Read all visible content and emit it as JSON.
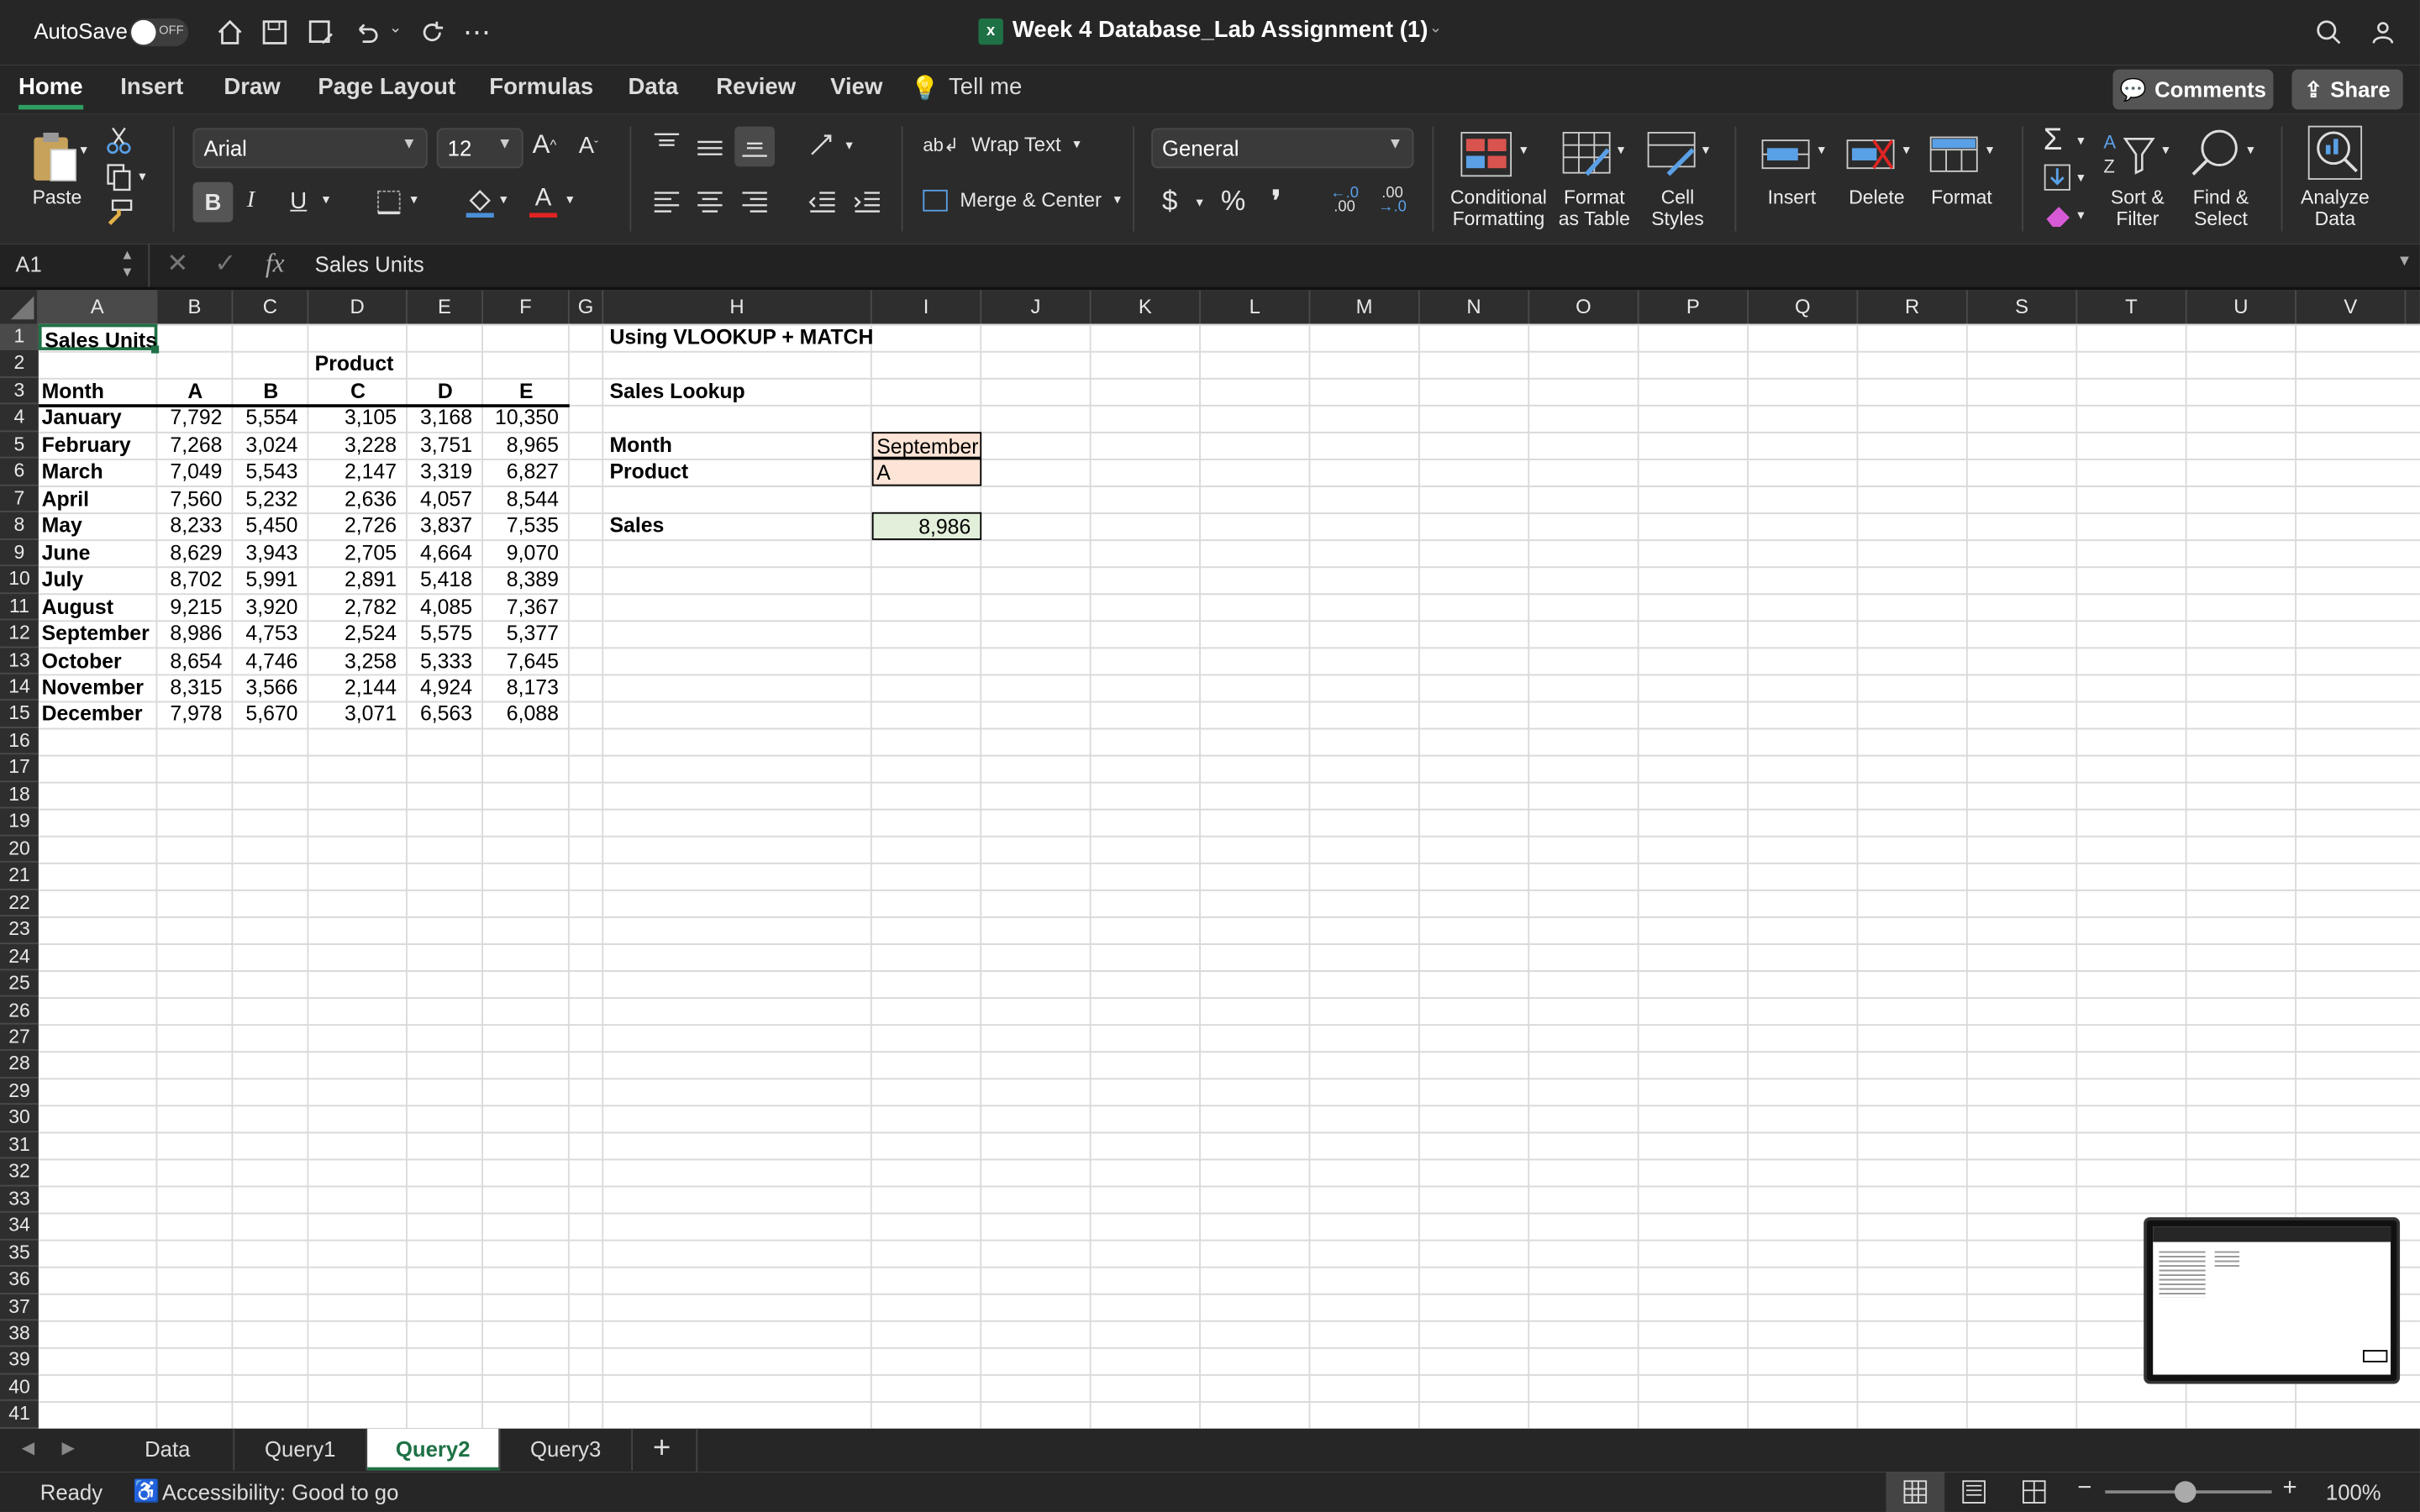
{
  "window": {
    "autosave_label": "AutoSave",
    "autosave_state": "OFF",
    "title": "Week 4 Database_Lab Assignment (1)"
  },
  "ribbon_tabs": [
    "Home",
    "Insert",
    "Draw",
    "Page Layout",
    "Formulas",
    "Data",
    "Review",
    "View"
  ],
  "tell_me": "Tell me",
  "comments_label": "Comments",
  "share_label": "Share",
  "home": {
    "paste": "Paste",
    "font_name": "Arial",
    "font_size": "12",
    "number_format": "General",
    "wrap_text": "Wrap Text",
    "merge_center": "Merge & Center",
    "conditional_formatting": [
      "Conditional",
      "Formatting"
    ],
    "format_as_table": [
      "Format",
      "as Table"
    ],
    "cell_styles": [
      "Cell",
      "Styles"
    ],
    "insert": "Insert",
    "delete": "Delete",
    "format": "Format",
    "sort_filter": [
      "Sort &",
      "Filter"
    ],
    "find_select": [
      "Find &",
      "Select"
    ],
    "analyze_data": [
      "Analyze",
      "Data"
    ]
  },
  "formula_bar": {
    "name_box": "A1",
    "fx": "fx",
    "content": "Sales Units"
  },
  "columns": [
    "A",
    "B",
    "C",
    "D",
    "E",
    "F",
    "G",
    "H",
    "I",
    "J",
    "K",
    "L",
    "M",
    "N",
    "O",
    "P",
    "Q",
    "R",
    "S",
    "T",
    "U",
    "V"
  ],
  "rows": [
    "1",
    "2",
    "3",
    "4",
    "5",
    "6",
    "7",
    "8",
    "9",
    "10",
    "11",
    "12",
    "13",
    "14",
    "15",
    "16",
    "17",
    "18",
    "19",
    "20",
    "21",
    "22",
    "23",
    "24",
    "25",
    "26",
    "27",
    "28",
    "29",
    "30",
    "31",
    "32",
    "33",
    "34",
    "35",
    "36",
    "37",
    "38",
    "39",
    "40",
    "41"
  ],
  "sheet": {
    "a1": "Sales Units",
    "product_header": "Product",
    "month_header": "Month",
    "products": [
      "A",
      "B",
      "C",
      "D",
      "E"
    ],
    "data": [
      [
        "January",
        "7,792",
        "5,554",
        "3,105",
        "3,168",
        "10,350"
      ],
      [
        "February",
        "7,268",
        "3,024",
        "3,228",
        "3,751",
        "8,965"
      ],
      [
        "March",
        "7,049",
        "5,543",
        "2,147",
        "3,319",
        "6,827"
      ],
      [
        "April",
        "7,560",
        "5,232",
        "2,636",
        "4,057",
        "8,544"
      ],
      [
        "May",
        "8,233",
        "5,450",
        "2,726",
        "3,837",
        "7,535"
      ],
      [
        "June",
        "8,629",
        "3,943",
        "2,705",
        "4,664",
        "9,070"
      ],
      [
        "July",
        "8,702",
        "5,991",
        "2,891",
        "5,418",
        "8,389"
      ],
      [
        "August",
        "9,215",
        "3,920",
        "2,782",
        "4,085",
        "7,367"
      ],
      [
        "September",
        "8,986",
        "4,753",
        "2,524",
        "5,575",
        "5,377"
      ],
      [
        "October",
        "8,654",
        "4,746",
        "3,258",
        "5,333",
        "7,645"
      ],
      [
        "November",
        "8,315",
        "3,566",
        "2,144",
        "4,924",
        "8,173"
      ],
      [
        "December",
        "7,978",
        "5,670",
        "3,071",
        "6,563",
        "6,088"
      ]
    ],
    "lookup_title": "Using VLOOKUP + MATCH",
    "lookup_subtitle": "Sales Lookup",
    "month_label": "Month",
    "month_value": "September",
    "product_label": "Product",
    "product_value": "A",
    "sales_label": "Sales",
    "sales_value": "8,986"
  },
  "sheet_tabs": [
    "Data",
    "Query1",
    "Query2",
    "Query3"
  ],
  "active_sheet": "Query2",
  "status": {
    "ready": "Ready",
    "accessibility": "Accessibility: Good to go",
    "zoom": "100%"
  },
  "colors": {
    "accent": "#1e7145",
    "input_fill": "#fce4d6",
    "output_fill": "#e2efda"
  }
}
